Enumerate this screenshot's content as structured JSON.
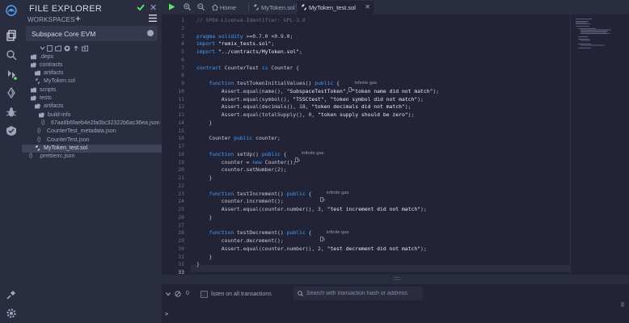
{
  "side_panel": {
    "title": "FILE EXPLORER",
    "workspaces_label": "WORKSPACES",
    "workspace_name": "Subspace Core EVM",
    "colors": {
      "accent": "#5de46c",
      "selected_row": "#41435a"
    }
  },
  "file_tree": [
    {
      "label": ".deps",
      "type": "folder",
      "depth": 1
    },
    {
      "label": "contracts",
      "type": "folder",
      "depth": 1
    },
    {
      "label": "artifacts",
      "type": "folder",
      "depth": 2
    },
    {
      "label": "MyToken.sol",
      "type": "sol",
      "depth": 2
    },
    {
      "label": "scripts",
      "type": "folder",
      "depth": 1
    },
    {
      "label": "tests",
      "type": "folder",
      "depth": 1
    },
    {
      "label": "artifacts",
      "type": "folder",
      "depth": 2
    },
    {
      "label": "build-info",
      "type": "folder",
      "depth": 3
    },
    {
      "label": "67aa8b6faeb4e2fa0bc32322b6ac36ea.json",
      "type": "json",
      "depth": 4
    },
    {
      "label": "CounterTest_metadata.json",
      "type": "json",
      "depth": 3
    },
    {
      "label": "CounterTest.json",
      "type": "json",
      "depth": 3
    },
    {
      "label": "MyToken_test.sol",
      "type": "sol",
      "depth": 2,
      "selected": true
    },
    {
      "label": ".prettierrc.json",
      "type": "json",
      "depth": 1
    }
  ],
  "tabs": [
    {
      "label": "Home",
      "icon": "home-icon",
      "active": false
    },
    {
      "label": "MyToken.sol",
      "icon": "solidity-icon",
      "active": false
    },
    {
      "label": "MyToken_test.sol",
      "icon": "solidity-icon",
      "active": true
    }
  ],
  "editor": {
    "current_line": 33,
    "gas_label": "infinite gas",
    "lines": [
      "// SPDX-License-Identifier: GPL-3.0",
      "",
      "pragma solidity >=0.7.0 <0.9.0;",
      "import \"remix_tests.sol\";",
      "import \"../contracts/MyToken.sol\";",
      "",
      "contract CounterTest is Counter {",
      "",
      "    function testTokenInitialValues() public {",
      "        Assert.equal(name(), \"SubspaceTestToken\", \"token name did not match\");",
      "        Assert.equal(symbol(), \"TSSCtest\", \"token symbol did not match\");",
      "        Assert.equal(decimals(), 18, \"token decimals did not match\");",
      "        Assert.equal(totalSupply(), 0, \"token supply should be zero\");",
      "    }",
      "",
      "    Counter public counter;",
      "",
      "    function setUp() public {",
      "        counter = new Counter();",
      "        counter.setNumber(2);",
      "    }",
      "",
      "    function testIncrement() public {",
      "        counter.increment();",
      "        Assert.equal(counter.number(), 3, \"test increment did not match\");",
      "    }",
      "",
      "    function testDecrement() public {",
      "        counter.decrement();",
      "        Assert.equal(counter.number(), 2, \"test decrement did not match\");",
      "    }",
      "}",
      ""
    ],
    "gas_lines": [
      9,
      18,
      23,
      28
    ]
  },
  "terminal": {
    "tx_count": "0",
    "listen_label": "listen on all transactions",
    "search_placeholder": "Search with transaction hash or address",
    "prompt": ">"
  },
  "colors": {
    "keyword": "#3f9fff",
    "comment": "#6c6e87",
    "play": "#5de46c"
  }
}
